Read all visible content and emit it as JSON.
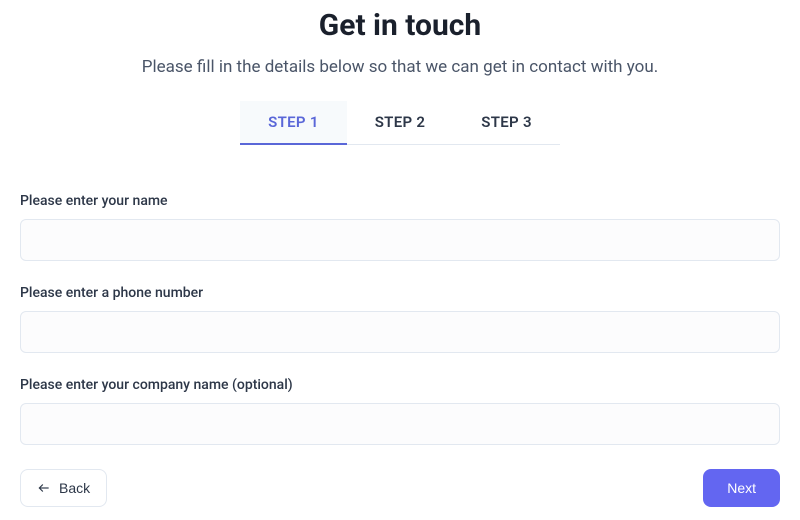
{
  "header": {
    "title": "Get in touch",
    "subtitle": "Please fill in the details below so that we can get in contact with you."
  },
  "tabs": [
    {
      "label": "STEP 1",
      "active": true
    },
    {
      "label": "STEP 2",
      "active": false
    },
    {
      "label": "STEP 3",
      "active": false
    }
  ],
  "form": {
    "fields": [
      {
        "label": "Please enter your name",
        "value": "",
        "placeholder": ""
      },
      {
        "label": "Please enter a phone number",
        "value": "",
        "placeholder": ""
      },
      {
        "label": "Please enter your company name (optional)",
        "value": "",
        "placeholder": ""
      }
    ]
  },
  "buttons": {
    "back": "Back",
    "next": "Next"
  }
}
